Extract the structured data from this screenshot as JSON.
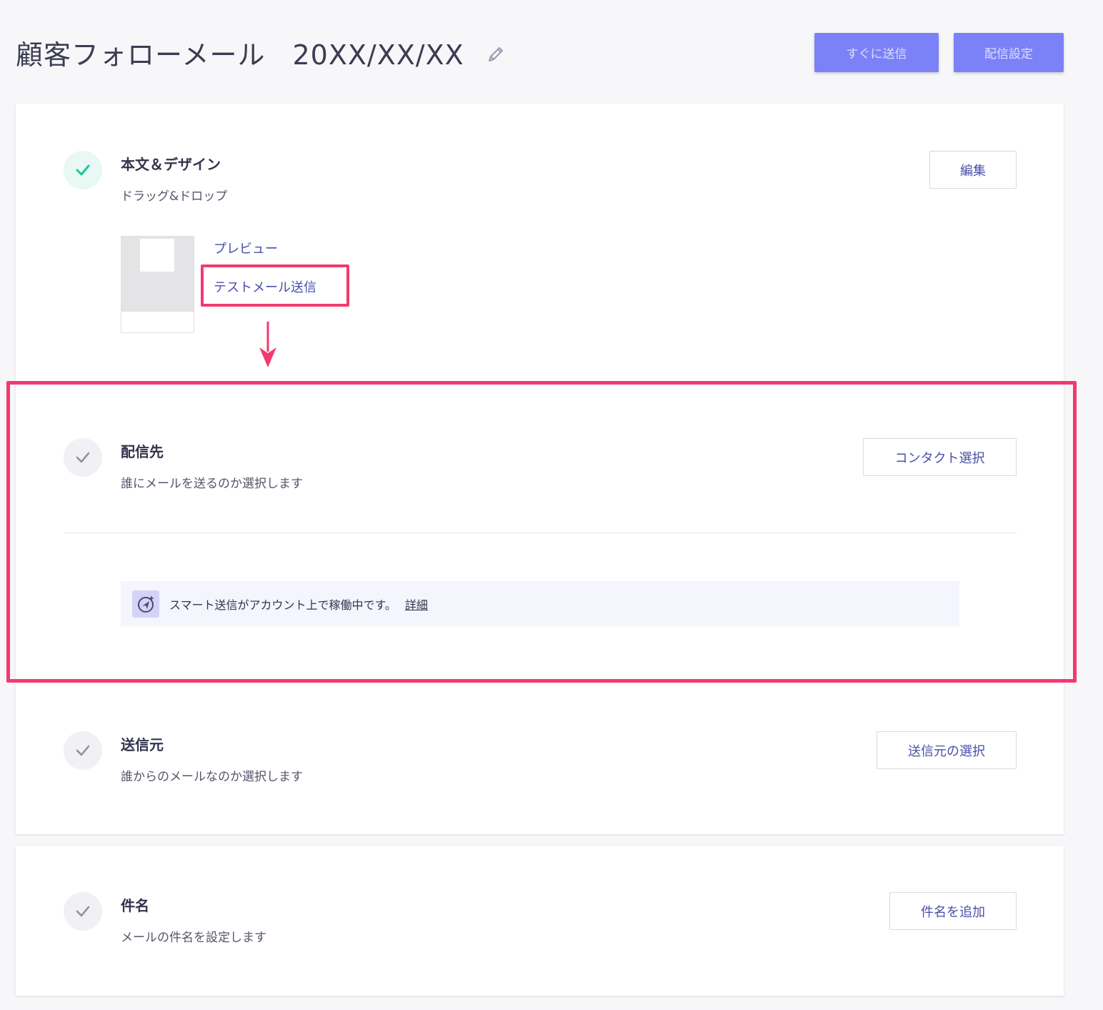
{
  "header": {
    "title": "顧客フォローメール",
    "date": "20XX/XX/XX",
    "edit_icon": "pencil-icon",
    "send_now_label": "すぐに送信",
    "delivery_settings_label": "配信設定"
  },
  "sections": {
    "content": {
      "title": "本文＆デザイン",
      "desc": "ドラッグ&ドロップ",
      "button": "編集",
      "preview_link": "プレビュー",
      "test_mail_link": "テストメール送信",
      "status": "done"
    },
    "recipients": {
      "title": "配信先",
      "desc": "誰にメールを送るのか選択します",
      "button": "コンタクト選択",
      "status": "todo"
    },
    "notice": {
      "text": "スマート送信がアカウント上で稼働中です。",
      "link": "詳細",
      "icon": "smart-send-icon"
    },
    "sender": {
      "title": "送信元",
      "desc": "誰からのメールなのか選択します",
      "button": "送信元の選択",
      "status": "todo"
    },
    "subject": {
      "title": "件名",
      "desc": "メールの件名を設定します",
      "button": "件名を追加",
      "status": "todo"
    }
  },
  "colors": {
    "accent": "#7b82f7",
    "link": "#4a4fa8",
    "highlight": "#f23a6e",
    "check_done": "#1fc59a",
    "check_todo": "#8e8ea4"
  }
}
